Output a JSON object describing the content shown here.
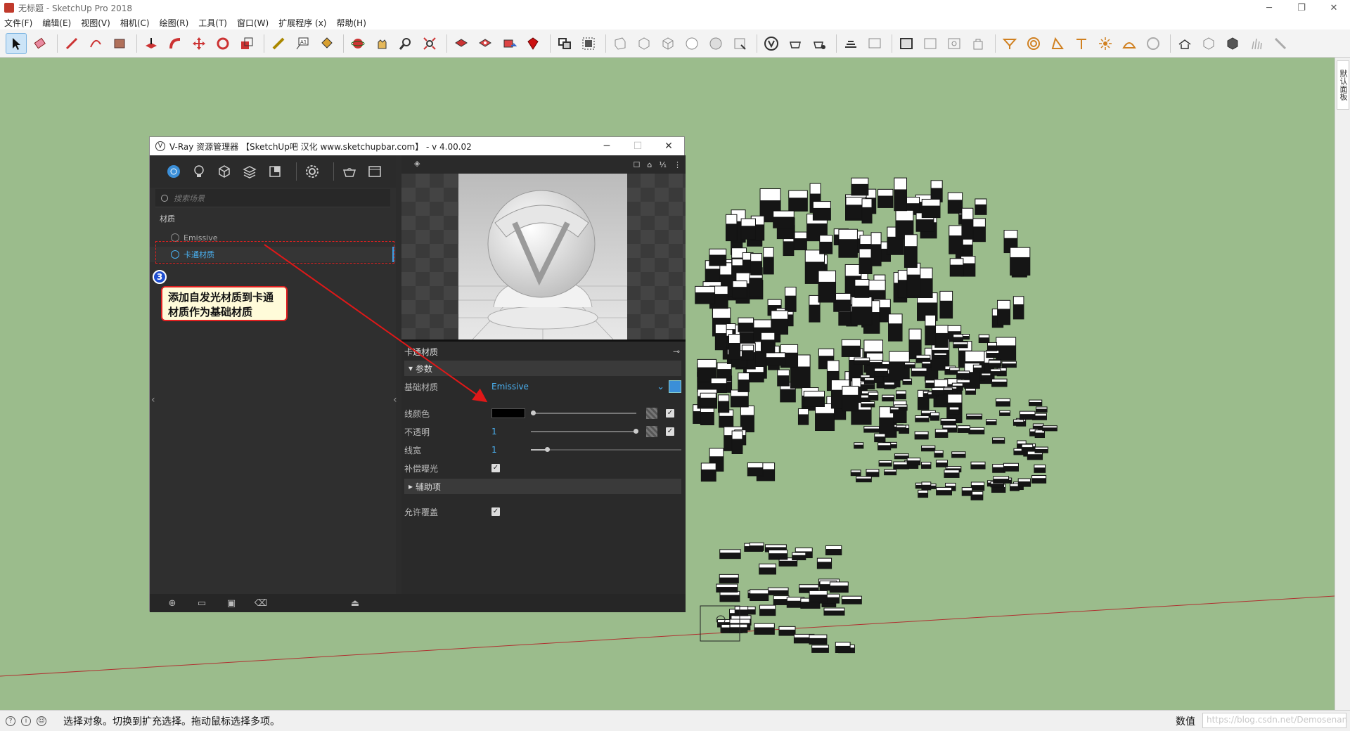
{
  "window": {
    "title": "无标题 - SketchUp Pro 2018",
    "controls": [
      "─",
      "❐",
      "✕"
    ]
  },
  "menubar": [
    "文件(F)",
    "编辑(E)",
    "视图(V)",
    "相机(C)",
    "绘图(R)",
    "工具(T)",
    "窗口(W)",
    "扩展程序 (x)",
    "帮助(H)"
  ],
  "toolbar": {
    "icons": [
      "select-tool-icon",
      "eraser-tool-icon",
      "pencil-line-icon",
      "arc-tool-icon",
      "rectangle-tool-icon",
      "push-pull-icon",
      "follow-me-icon",
      "move-tool-icon",
      "rotate-tool-icon",
      "scale-tool-icon",
      "tape-measure-icon",
      "text-tool-icon",
      "paint-bucket-icon",
      "orbit-icon",
      "pan-icon",
      "zoom-icon",
      "zoom-extents-icon",
      "warehouse-icon",
      "extension-warehouse-icon",
      "share-model-icon",
      "ruby-icon",
      "components-icon",
      "groups-icon",
      "xray-icon",
      "back-edges-icon",
      "wireframe-icon",
      "hidden-line-icon",
      "shaded-icon",
      "shaded-textures-icon",
      "monochrome-icon",
      "vray-logo-icon",
      "vray-teapot-icon",
      "vray-interactive-icon",
      "vray-frame-buffer-icon",
      "vray-lights-icon",
      "vray-render-icon",
      "vray-batch-icon",
      "section-icon",
      "dome-light-icon",
      "sphere-light-icon",
      "spot-light-icon",
      "omni-light-icon",
      "mesh-light-icon",
      "ies-light-icon",
      "infinite-plane-icon",
      "proxy-icon",
      "export-proxy-icon",
      "fur-icon",
      "clipper-icon"
    ]
  },
  "tray": {
    "label": "默认面板"
  },
  "statusbar": {
    "message": "选择对象。切换到扩充选择。拖动鼠标选择多项。",
    "measure_label": "数值",
    "watermark": "https://blog.csdn.net/Demosenan"
  },
  "vray": {
    "title": "V-Ray 资源管理器 【SketchUp吧 汉化 www.sketchupbar.com】 - v 4.00.02",
    "controls": [
      "─",
      "☐",
      "✕"
    ],
    "search_placeholder": "搜索场景",
    "list_title": "材质",
    "materials": [
      "Emissive",
      "卡通材质"
    ],
    "annotation_number": "3",
    "annotation_text": "添加自发光材质到卡通材质作为基础材质",
    "preview_toolbar": [
      "☐",
      "⌂",
      "¹⁄₁",
      "⋮"
    ],
    "panel_title": "卡通材质",
    "section_params": "参数",
    "section_aux": "辅助项",
    "rows": {
      "base_material_label": "基础材质",
      "base_material_value": "Emissive",
      "line_color_label": "线颜色",
      "opacity_label": "不透明",
      "opacity_value": "1",
      "line_width_label": "线宽",
      "line_width_value": "1",
      "compensate_label": "补偿曝光",
      "allow_override_label": "允许覆盖"
    },
    "checkbox_state": "✓"
  }
}
